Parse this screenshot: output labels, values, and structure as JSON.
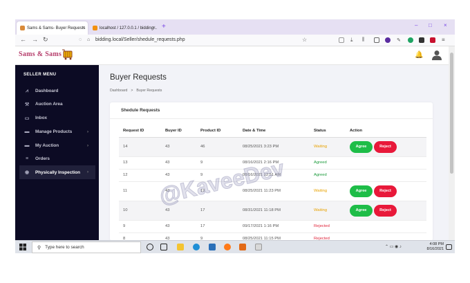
{
  "browser": {
    "tabs": [
      {
        "label": "Sams & Sams- Buyer Requests",
        "close": "×"
      },
      {
        "label": "localhost / 127.0.0.1 / bidding...",
        "close": "×"
      }
    ],
    "new_tab": "+",
    "window_controls": [
      "–",
      "□",
      "×"
    ],
    "url": "bidding.local/Seller/shedule_requests.php",
    "accent": "#7542e5"
  },
  "header": {
    "logo": "Sams & Sams"
  },
  "sidebar": {
    "title": "SELLER MENU",
    "items": [
      {
        "label": "Dashboard",
        "icon": "chart-icon",
        "glyph": "⩘",
        "chevron": ""
      },
      {
        "label": "Auction Area",
        "icon": "gavel-icon",
        "glyph": "⚒",
        "chevron": ""
      },
      {
        "label": "Inbox",
        "icon": "inbox-icon",
        "glyph": "▭",
        "chevron": ""
      },
      {
        "label": "Manage Products",
        "icon": "folder-icon",
        "glyph": "▬",
        "chevron": "›"
      },
      {
        "label": "My Auction",
        "icon": "folder-icon",
        "glyph": "▬",
        "chevron": "›"
      },
      {
        "label": "Orders",
        "icon": "database-icon",
        "glyph": "≡",
        "chevron": ""
      },
      {
        "label": "Physically Inspection",
        "icon": "eye-icon",
        "glyph": "◉",
        "chevron": "›"
      }
    ]
  },
  "main": {
    "title": "Buyer Requests",
    "breadcrumb": [
      "Dashboard",
      ">",
      "Buyer Requests"
    ],
    "card_title": "Shedule Requests",
    "columns": [
      "Request ID",
      "Buyer ID",
      "Product ID",
      "Date & Time",
      "Status",
      "Action"
    ],
    "rows": [
      {
        "request_id": "14",
        "buyer_id": "43",
        "product_id": "46",
        "datetime": "08/25/2021 3:23 PM",
        "status": "Waiting"
      },
      {
        "request_id": "13",
        "buyer_id": "43",
        "product_id": "9",
        "datetime": "08/16/2021 2:16 PM",
        "status": "Agreed"
      },
      {
        "request_id": "12",
        "buyer_id": "43",
        "product_id": "9",
        "datetime": "08/16/2021 12:51 AM",
        "status": "Agreed"
      },
      {
        "request_id": "11",
        "buyer_id": "43",
        "product_id": "19",
        "datetime": "08/25/2021 11:23 PM",
        "status": "Waiting"
      },
      {
        "request_id": "10",
        "buyer_id": "43",
        "product_id": "17",
        "datetime": "08/31/2021 11:18 PM",
        "status": "Waiting"
      },
      {
        "request_id": "9",
        "buyer_id": "43",
        "product_id": "17",
        "datetime": "09/17/2021 1:16 PM",
        "status": "Rejected"
      },
      {
        "request_id": "8",
        "buyer_id": "43",
        "product_id": "9",
        "datetime": "08/25/2021 11:15 PM",
        "status": "Rejected"
      }
    ],
    "agree_label": "Agree",
    "reject_label": "Reject"
  },
  "watermark": "@KaveeDev",
  "taskbar": {
    "search_placeholder": "Type here to search",
    "time": "4:08 PM",
    "date": "8/16/2021"
  }
}
